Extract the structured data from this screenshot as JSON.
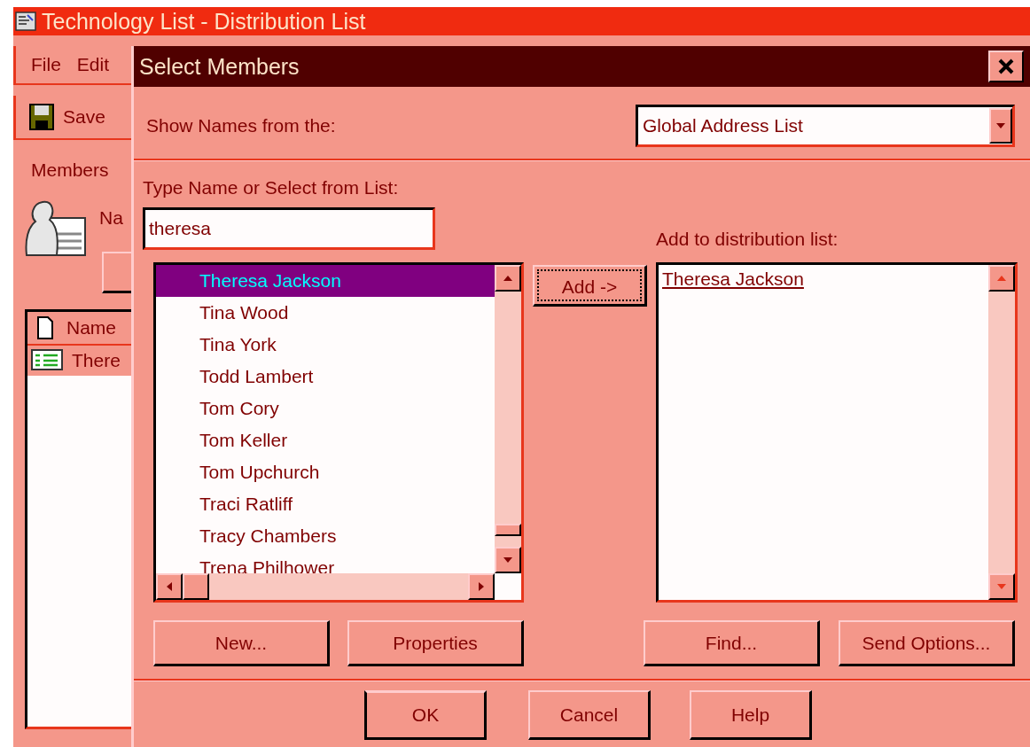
{
  "window": {
    "title": "Technology List - Distribution List"
  },
  "background_window": {
    "menu": [
      {
        "label": "File"
      },
      {
        "label": "Edit"
      }
    ],
    "toolbar": {
      "label": "Save"
    },
    "tab": "Members",
    "name_label": {
      "label": "Na"
    },
    "members_list": {
      "column": "Name",
      "rows": [
        "There"
      ]
    }
  },
  "dialog": {
    "title": "Select Members",
    "show_names_label": {
      "label": "Show Names from the:"
    },
    "address_book": "Global Address List",
    "type_name_label": {
      "label": "Type Name or Select from List:"
    },
    "search": {
      "value": "theresa"
    },
    "names": [
      {
        "name": "Theresa Jackson",
        "selected": true
      },
      {
        "name": "Tina Wood",
        "selected": false
      },
      {
        "name": "Tina York",
        "selected": false
      },
      {
        "name": "Todd Lambert",
        "selected": false
      },
      {
        "name": "Tom Cory",
        "selected": false
      },
      {
        "name": "Tom Keller",
        "selected": false
      },
      {
        "name": "Tom Upchurch",
        "selected": false
      },
      {
        "name": "Traci Ratliff",
        "selected": false
      },
      {
        "name": "Tracy Chambers",
        "selected": false
      },
      {
        "name": "Trena Philhower",
        "selected": false
      }
    ],
    "add_button": {
      "label": "Add ->",
      "focused": true
    },
    "distribution_label": "Add to distribution list:",
    "distribution": [
      {
        "name": "Theresa Jackson",
        "resolved": true
      }
    ],
    "buttons": [
      {
        "label": "New..."
      },
      {
        "label": "Properties"
      },
      {
        "label": "Find..."
      },
      {
        "label": "Send Options..."
      }
    ],
    "footer_buttons": [
      {
        "label": "OK",
        "default": true
      },
      {
        "label": "Cancel",
        "default": false
      },
      {
        "label": "Help",
        "default": false
      }
    ]
  }
}
